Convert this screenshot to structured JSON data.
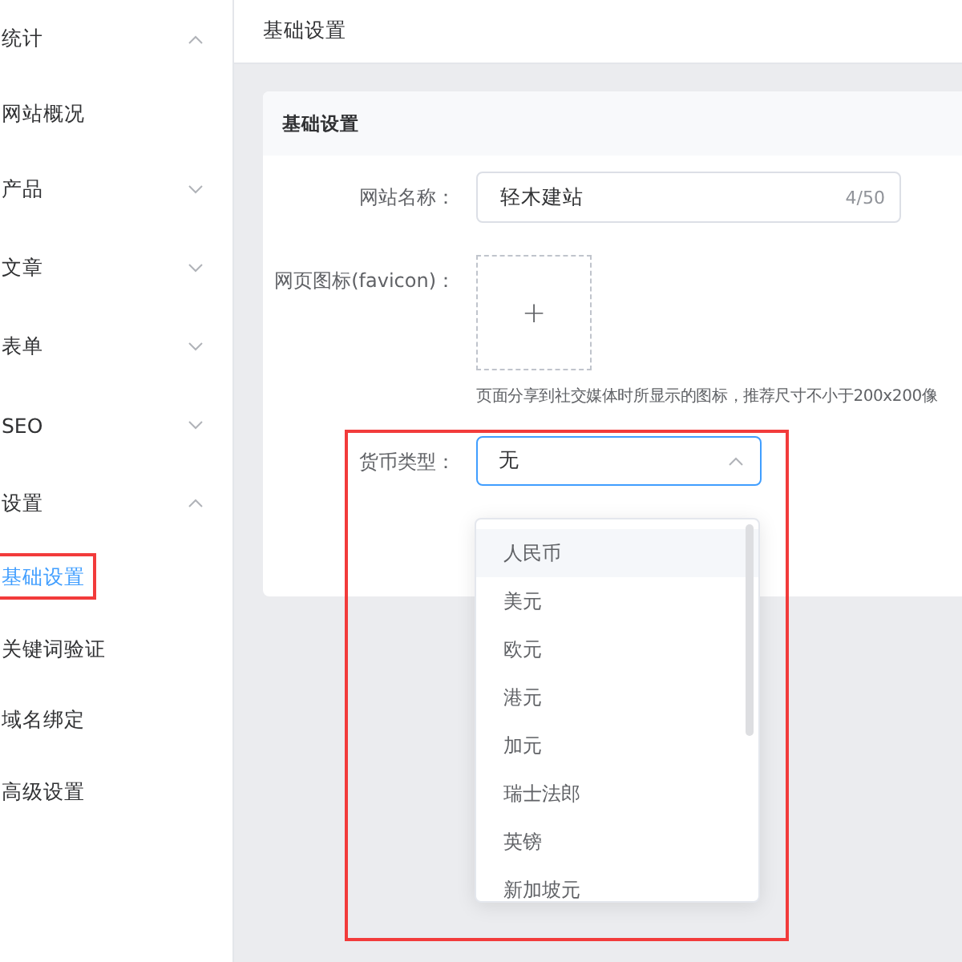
{
  "sidebar": {
    "groups": [
      {
        "label": "统计",
        "expanded": true,
        "children": [
          {
            "label": "网站概况",
            "selected": false
          }
        ]
      },
      {
        "label": "产品",
        "expanded": false
      },
      {
        "label": "文章",
        "expanded": false
      },
      {
        "label": "表单",
        "expanded": false
      },
      {
        "label": "SEO",
        "expanded": false
      },
      {
        "label": "设置",
        "expanded": true,
        "children": [
          {
            "label": "基础设置",
            "selected": true
          },
          {
            "label": "关键词验证",
            "selected": false
          },
          {
            "label": "域名绑定",
            "selected": false
          },
          {
            "label": "高级设置",
            "selected": false
          }
        ]
      }
    ]
  },
  "header": {
    "title": "基础设置"
  },
  "card": {
    "title": "基础设置",
    "site_name": {
      "label": "网站名称：",
      "value": "轻木建站",
      "counter": "4/50"
    },
    "favicon": {
      "label": "网页图标(favicon)：",
      "upload_symbol": "+",
      "hint": "页面分享到社交媒体时所显示的图标，推荐尺寸不小于200x200像"
    },
    "currency": {
      "label": "货币类型：",
      "value": "无",
      "expanded": true,
      "options": [
        {
          "label": "人民币",
          "hovered": true
        },
        {
          "label": "美元",
          "hovered": false
        },
        {
          "label": "欧元",
          "hovered": false
        },
        {
          "label": "港元",
          "hovered": false
        },
        {
          "label": "加元",
          "hovered": false
        },
        {
          "label": "瑞士法郎",
          "hovered": false
        },
        {
          "label": "英镑",
          "hovered": false
        },
        {
          "label": "新加坡元",
          "hovered": false
        }
      ]
    }
  }
}
